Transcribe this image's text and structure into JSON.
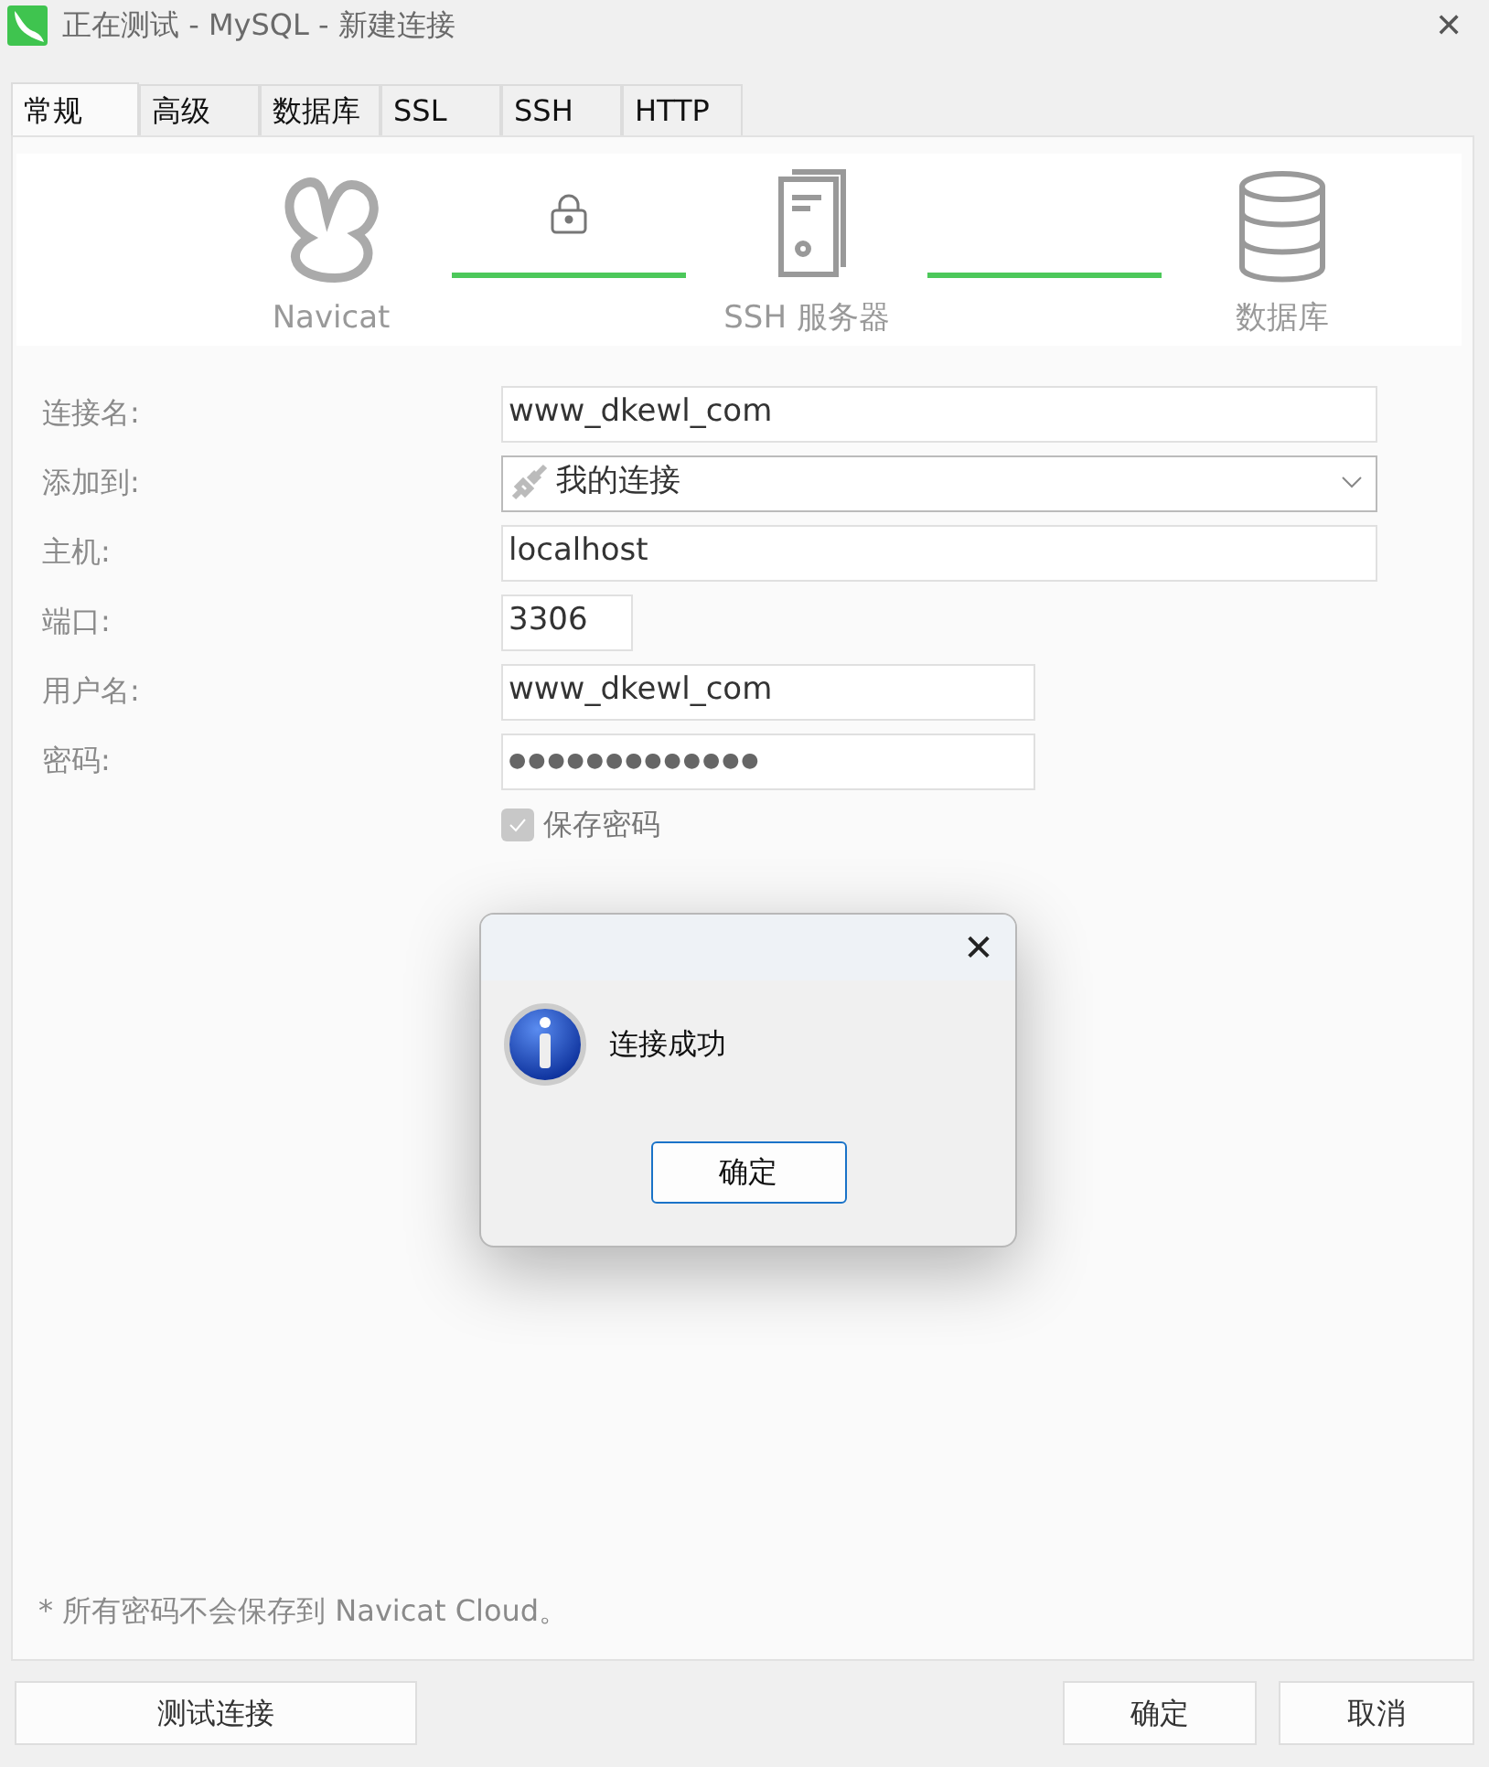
{
  "window": {
    "title": "正在测试 - MySQL - 新建连接",
    "close": "✕"
  },
  "tabs": [
    {
      "label": "常规",
      "selected": true
    },
    {
      "label": "高级",
      "selected": false
    },
    {
      "label": "数据库",
      "selected": false
    },
    {
      "label": "SSL",
      "selected": false
    },
    {
      "label": "SSH",
      "selected": false
    },
    {
      "label": "HTTP",
      "selected": false
    }
  ],
  "diagram": {
    "nodes": [
      {
        "label": "Navicat",
        "kind": "navicat"
      },
      {
        "label": "SSH 服务器",
        "kind": "server"
      },
      {
        "label": "数据库",
        "kind": "database"
      }
    ]
  },
  "form": [
    {
      "label": "连接名:",
      "kind": "text",
      "value": "www_dkewl_com"
    },
    {
      "label": "添加到:",
      "kind": "combo",
      "value": "我的连接"
    },
    {
      "label": "主机:",
      "kind": "text",
      "value": "localhost"
    },
    {
      "label": "端口:",
      "kind": "text",
      "value": "3306"
    },
    {
      "label": "用户名:",
      "kind": "text",
      "value": "www_dkewl_com"
    },
    {
      "label": "密码:",
      "kind": "password",
      "value": "●●●●●●●●●●●●●"
    }
  ],
  "save_password": {
    "label": "保存密码",
    "checked": true
  },
  "note": "* 所有密码不会保存到 Navicat Cloud。",
  "buttons": {
    "test": "测试连接",
    "ok": "确定",
    "cancel": "取消"
  },
  "dialog": {
    "message": "连接成功",
    "button": "确定",
    "close": "✕"
  }
}
